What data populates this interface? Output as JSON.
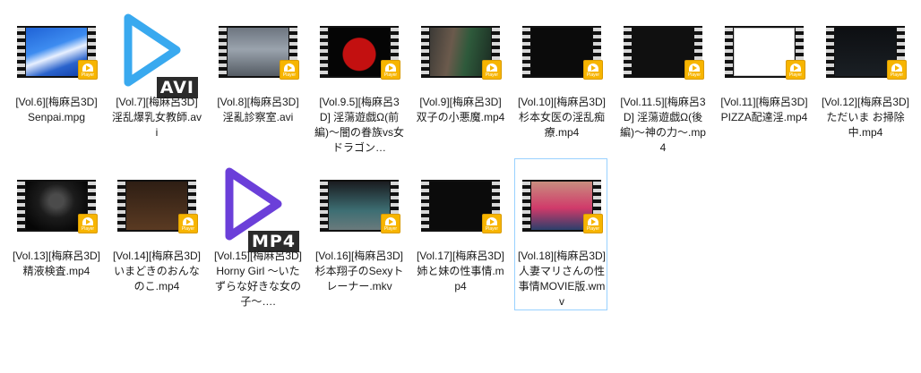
{
  "badge_text": "Player",
  "files": [
    {
      "label": "[Vol.6][梅麻呂3D] Senpai.mpg",
      "kind": "video",
      "scene": "sky"
    },
    {
      "label": "[Vol.7][梅麻呂3D] 淫乱爆乳女教師.avi",
      "kind": "icon",
      "ext": "AVI",
      "color": "#39a9ef"
    },
    {
      "label": "[Vol.8][梅麻呂3D] 淫亂診察室.avi",
      "kind": "video",
      "scene": "room"
    },
    {
      "label": "[Vol.9.5][梅麻呂3D] 淫蕩遊戯Ω(前編)～闇の眷族vs女ドラゴン…",
      "kind": "video",
      "scene": "red"
    },
    {
      "label": "[Vol.9][梅麻呂3D] 双子の小悪魔.mp4",
      "kind": "video",
      "scene": "twins"
    },
    {
      "label": "[Vol.10][梅麻呂3D] 杉本女医の淫乱痴療.mp4",
      "kind": "video",
      "scene": "logo"
    },
    {
      "label": "[Vol.11.5][梅麻呂3D] 淫蕩遊戯Ω(後編)～神の力～.mp4",
      "kind": "video",
      "scene": "text"
    },
    {
      "label": "[Vol.11][梅麻呂3D] PIZZA配達淫.mp4",
      "kind": "video",
      "scene": "white"
    },
    {
      "label": "[Vol.12][梅麻呂3D] ただいま お掃除中.mp4",
      "kind": "video",
      "scene": "dark"
    },
    {
      "label": "[Vol.13][梅麻呂3D] 精液検査.mp4",
      "kind": "video",
      "scene": "hall"
    },
    {
      "label": "[Vol.14][梅麻呂3D] いまどきのおんなのこ.mp4",
      "kind": "video",
      "scene": "brown"
    },
    {
      "label": "[Vol.15][梅麻呂3D] Horny Girl ～いたずらな好きな女の子～….",
      "kind": "icon",
      "ext": "MP4",
      "color": "#6b3fd9"
    },
    {
      "label": "[Vol.16][梅麻呂3D] 杉本翔子のSexyトレーナー.mkv",
      "kind": "video",
      "scene": "gym"
    },
    {
      "label": "[Vol.17][梅麻呂3D] 姉と妹の性事情.mp4",
      "kind": "video",
      "scene": "title"
    },
    {
      "label": "[Vol.18][梅麻呂3D] 人妻マリさんの性事情MOVIE版.wmv",
      "kind": "video",
      "scene": "pink",
      "selected": true
    }
  ]
}
